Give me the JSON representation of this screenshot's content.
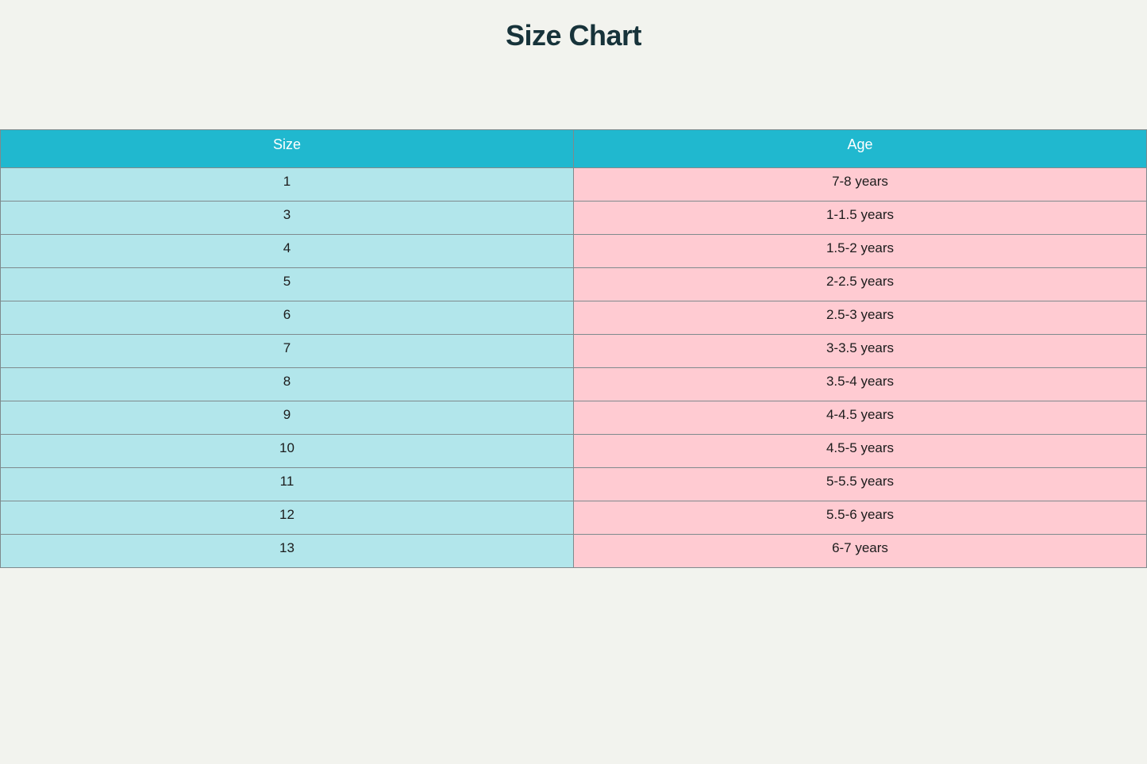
{
  "page": {
    "title": "Size Chart"
  },
  "colors": {
    "background": "#f2f3ee",
    "header": "#20b8cf",
    "size_column": "#b2e6eb",
    "age_column": "#ffcbd2",
    "title": "#17333a",
    "border": "#7f8a8d"
  },
  "chart_data": {
    "type": "table",
    "title": "Size Chart",
    "columns": [
      "Size",
      "Age"
    ],
    "rows": [
      [
        "1",
        "7-8 years"
      ],
      [
        "3",
        "1-1.5 years"
      ],
      [
        "4",
        "1.5-2 years"
      ],
      [
        "5",
        "2-2.5 years"
      ],
      [
        "6",
        "2.5-3 years"
      ],
      [
        "7",
        "3-3.5 years"
      ],
      [
        "8",
        "3.5-4 years"
      ],
      [
        "9",
        "4-4.5 years"
      ],
      [
        "10",
        "4.5-5 years"
      ],
      [
        "11",
        "5-5.5 years"
      ],
      [
        "12",
        "5.5-6 years"
      ],
      [
        "13",
        "6-7 years"
      ]
    ]
  }
}
